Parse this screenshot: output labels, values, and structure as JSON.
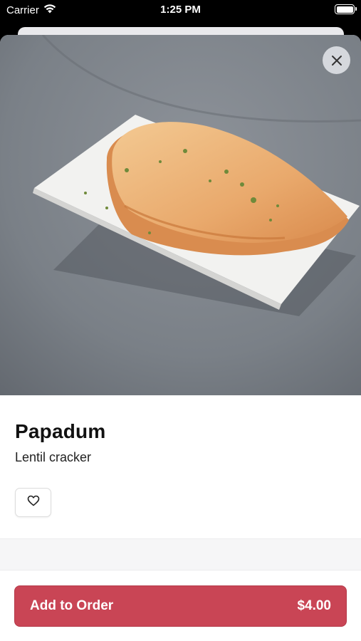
{
  "status_bar": {
    "carrier": "Carrier",
    "time": "1:25 PM"
  },
  "item": {
    "name": "Papadum",
    "description": "Lentil cracker"
  },
  "order_button": {
    "label": "Add to Order",
    "price": "$4.00"
  },
  "icons": {
    "close": "close-icon",
    "favorite": "heart-icon",
    "wifi": "wifi-icon",
    "battery": "battery-icon"
  },
  "colors": {
    "accent": "#c94555",
    "background": "#ffffff",
    "hero_background": "#7c8289"
  }
}
